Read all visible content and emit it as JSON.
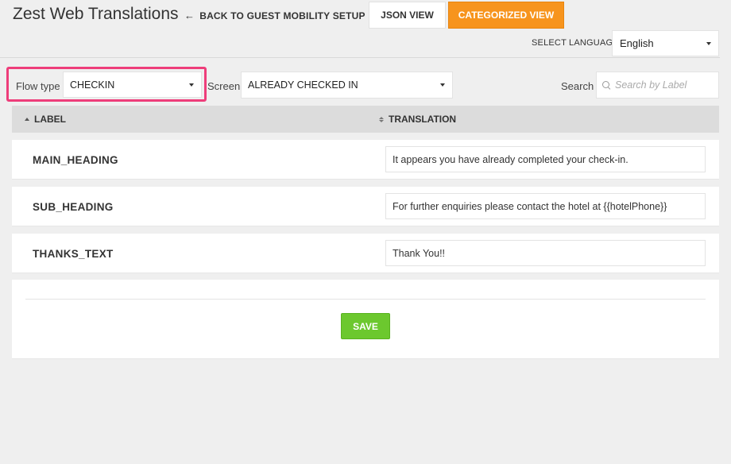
{
  "header": {
    "title": "Zest Web Translations",
    "back_label": "BACK TO GUEST MOBILITY SETUP",
    "json_view_label": "JSON VIEW",
    "categorized_view_label": "CATEGORIZED VIEW",
    "accent_color": "#f7941d"
  },
  "language": {
    "label": "SELECT LANGUAGE",
    "selected": "English"
  },
  "filters": {
    "flow_type_label": "Flow type",
    "flow_type_value": "CHECKIN",
    "screen_label": "Screen",
    "screen_value": "ALREADY CHECKED IN",
    "search_label": "Search",
    "search_placeholder": "Search by Label",
    "highlight_color": "#ee3d7a"
  },
  "table": {
    "col_label": "LABEL",
    "col_translation": "TRANSLATION",
    "rows": [
      {
        "key": "MAIN_HEADING",
        "value": "It appears you have already completed your check-in."
      },
      {
        "key": "SUB_HEADING",
        "value": "For further enquiries please contact the hotel at {{hotelPhone}}"
      },
      {
        "key": "THANKS_TEXT",
        "value": "Thank You!!"
      }
    ]
  },
  "footer": {
    "save_label": "SAVE",
    "save_color": "#6cc82e"
  }
}
